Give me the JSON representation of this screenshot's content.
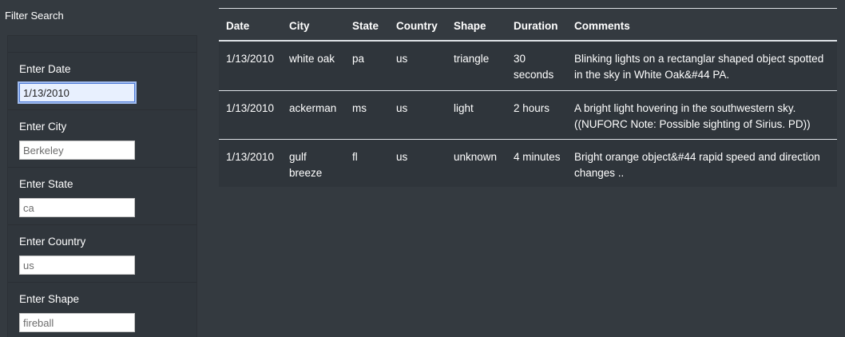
{
  "sidebar": {
    "title": "Filter Search",
    "filters": [
      {
        "label": "Enter Date",
        "value": "1/13/2010",
        "placeholder": ""
      },
      {
        "label": "Enter City",
        "value": "",
        "placeholder": "Berkeley"
      },
      {
        "label": "Enter State",
        "value": "",
        "placeholder": "ca"
      },
      {
        "label": "Enter Country",
        "value": "",
        "placeholder": "us"
      },
      {
        "label": "Enter Shape",
        "value": "",
        "placeholder": "fireball"
      }
    ]
  },
  "table": {
    "headers": [
      "Date",
      "City",
      "State",
      "Country",
      "Shape",
      "Duration",
      "Comments"
    ],
    "rows": [
      [
        "1/13/2010",
        "white oak",
        "pa",
        "us",
        "triangle",
        "30 seconds",
        "Blinking lights on a rectanglar shaped object spotted in the sky in White Oak&#44 PA."
      ],
      [
        "1/13/2010",
        "ackerman",
        "ms",
        "us",
        "light",
        "2 hours",
        "A bright light hovering in the southwestern sky. ((NUFORC Note: Possible sighting of Sirius. PD))"
      ],
      [
        "1/13/2010",
        "gulf breeze",
        "fl",
        "us",
        "unknown",
        "4 minutes",
        "Bright orange object&#44 rapid speed and direction changes .."
      ]
    ]
  }
}
